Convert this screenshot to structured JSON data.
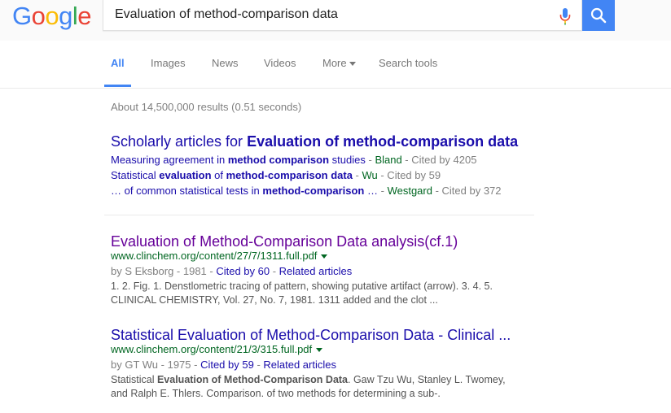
{
  "logo": {
    "letters": [
      "G",
      "o",
      "o",
      "g",
      "l",
      "e"
    ],
    "colors": [
      "#4285f4",
      "#ea4335",
      "#fbbc05",
      "#4285f4",
      "#34a853",
      "#ea4335"
    ]
  },
  "search": {
    "query": "Evaluation of method-comparison data"
  },
  "tabs": [
    {
      "label": "All",
      "active": true
    },
    {
      "label": "Images"
    },
    {
      "label": "News"
    },
    {
      "label": "Videos"
    },
    {
      "label": "More"
    },
    {
      "label": "Search tools"
    }
  ],
  "stats": "About 14,500,000 results (0.51 seconds)",
  "scholarly": {
    "title_prefix": "Scholarly articles for ",
    "title_query": "Evaluation of method-comparison data",
    "items": [
      {
        "parts": [
          [
            "Measuring agreement in ",
            false
          ],
          [
            "method comparison",
            true
          ],
          [
            " studies",
            false
          ]
        ],
        "sep": " - ",
        "author": "Bland",
        "cited": " - Cited by 4205"
      },
      {
        "parts": [
          [
            "Statistical ",
            false
          ],
          [
            "evaluation",
            true
          ],
          [
            " of ",
            false
          ],
          [
            "method-comparison data",
            true
          ]
        ],
        "sep": " - ",
        "author": "Wu",
        "cited": " - Cited by 59"
      },
      {
        "parts": [
          [
            "… of common statistical tests in ",
            false
          ],
          [
            "method-comparison",
            true
          ],
          [
            " …",
            false
          ]
        ],
        "sep": " - ",
        "author": "Westgard",
        "cited": " - Cited by 372"
      }
    ]
  },
  "results": [
    {
      "title": "Evaluation of Method-Comparison Data analysis(cf.1)",
      "url": "www.clinchem.org/content/27/7/1311.full.pdf",
      "meta_prefix": "by S Eksborg - 1981 - ",
      "cited": "Cited by 60",
      "related": "Related articles",
      "snippet1": "1. 2. Fig. 1. Denstlometric tracing of pattern, showing putative artifact (arrow). 3. 4. 5.",
      "snippet2": "CLINICAL CHEMISTRY, Vol. 27, No. 7, 1981. 1311 added and the clot ..."
    },
    {
      "title": "Statistical Evaluation of Method-Comparison Data - Clinical ...",
      "url": "www.clinchem.org/content/21/3/315.full.pdf",
      "meta_prefix": "by GT Wu - 1975 - ",
      "cited": "Cited by 59",
      "related": "Related articles",
      "snippet1_a": "Statistical ",
      "snippet1_b": "Evaluation of Method-Comparison Data",
      "snippet1_c": ". Gaw Tzu Wu, Stanley L. Twomey,",
      "snippet2": "and Ralph E. Thlers. Comparison. of two methods for determining a sub-."
    }
  ]
}
